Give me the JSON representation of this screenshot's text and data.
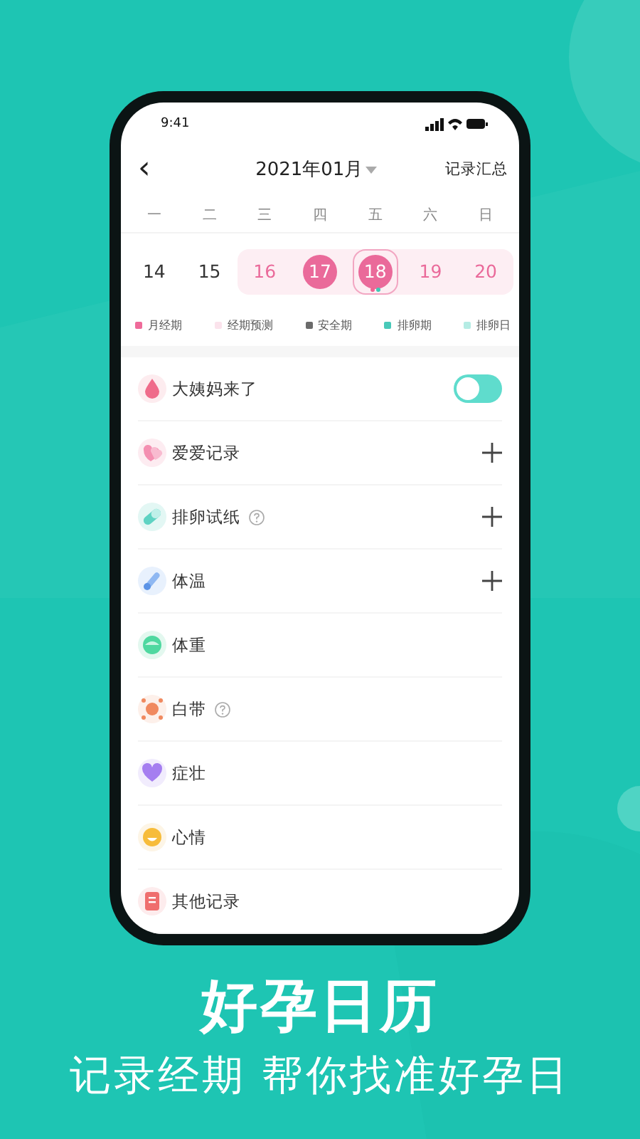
{
  "status_bar": {
    "time": "9:41"
  },
  "header": {
    "back": "‹",
    "title": "2021年01月",
    "action": "记录汇总"
  },
  "weekdays": [
    "一",
    "二",
    "三",
    "四",
    "五",
    "六",
    "日"
  ],
  "days": [
    {
      "label": "14",
      "in_period": false,
      "filled": false,
      "selected": false,
      "has_events": false
    },
    {
      "label": "15",
      "in_period": false,
      "filled": false,
      "selected": false,
      "has_events": false
    },
    {
      "label": "16",
      "in_period": true,
      "filled": false,
      "selected": false,
      "has_events": false
    },
    {
      "label": "17",
      "in_period": true,
      "filled": true,
      "selected": false,
      "has_events": false
    },
    {
      "label": "18",
      "in_period": true,
      "filled": true,
      "selected": true,
      "has_events": true
    },
    {
      "label": "19",
      "in_period": true,
      "filled": false,
      "selected": false,
      "has_events": false
    },
    {
      "label": "20",
      "in_period": true,
      "filled": false,
      "selected": false,
      "has_events": false
    }
  ],
  "legend": [
    {
      "label": "月经期",
      "color": "#ef6b9a"
    },
    {
      "label": "经期预测",
      "color": "#fbe3ec"
    },
    {
      "label": "安全期",
      "color": "#6b6b6b"
    },
    {
      "label": "排卵期",
      "color": "#49c9b9"
    },
    {
      "label": "排卵日",
      "color": "#b5ece4"
    }
  ],
  "records": [
    {
      "label": "大姨妈来了",
      "help": false,
      "kind": "toggle",
      "on": false
    },
    {
      "label": "爱爱记录",
      "help": false,
      "kind": "add"
    },
    {
      "label": "排卵试纸",
      "help": true,
      "kind": "add"
    },
    {
      "label": "体温",
      "help": false,
      "kind": "add"
    },
    {
      "label": "体重",
      "help": false,
      "kind": "plain"
    },
    {
      "label": "白带",
      "help": true,
      "kind": "plain"
    },
    {
      "label": "症壮",
      "help": false,
      "kind": "plain"
    },
    {
      "label": "心情",
      "help": false,
      "kind": "plain"
    },
    {
      "label": "其他记录",
      "help": false,
      "kind": "plain"
    }
  ],
  "promo": {
    "title": "好孕日历",
    "subtitle": "记录经期 帮你找准好孕日"
  }
}
